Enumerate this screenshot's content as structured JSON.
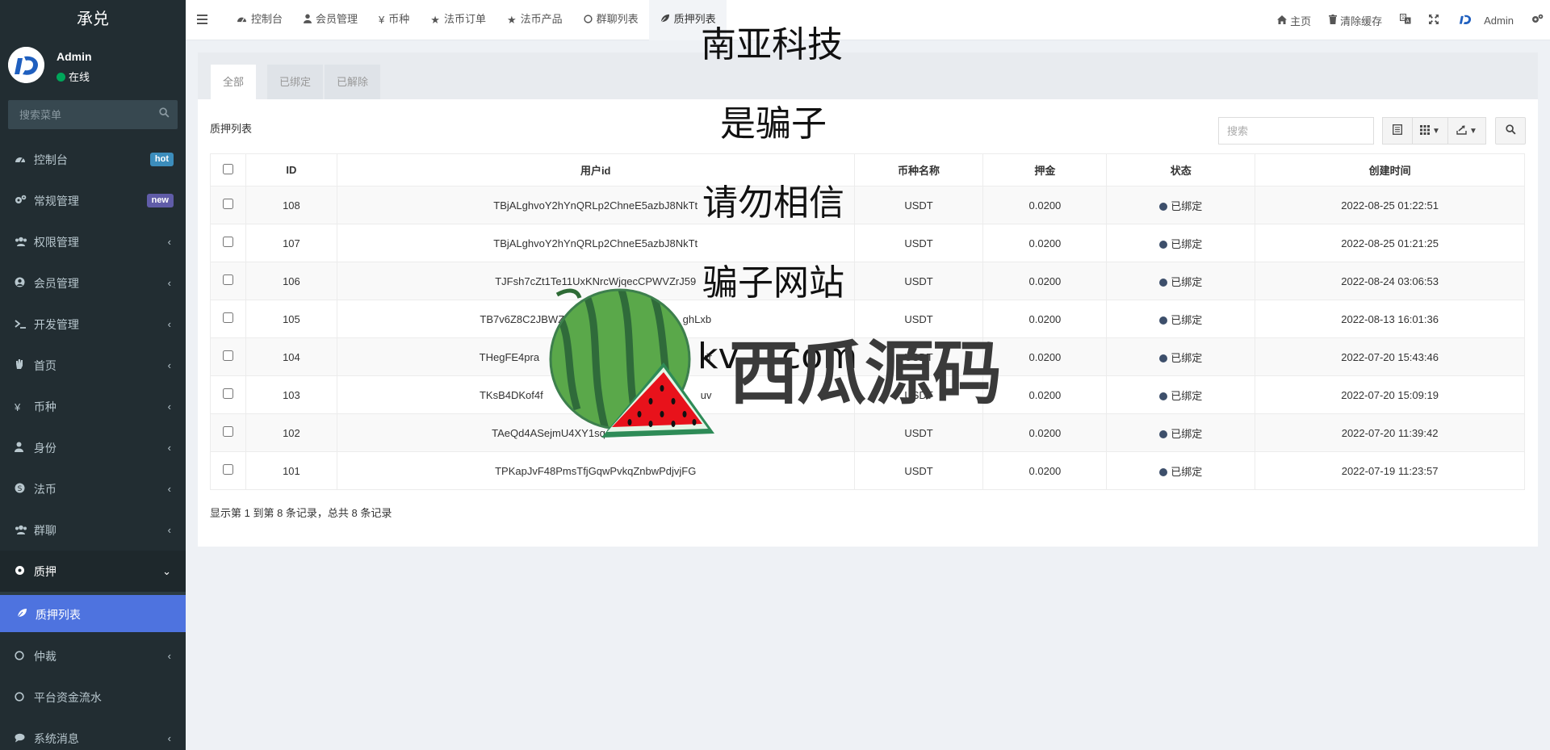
{
  "sidebar": {
    "brand": "承兑",
    "user": {
      "name": "Admin",
      "status": "在线"
    },
    "search_placeholder": "搜索菜单",
    "items": [
      {
        "label": "控制台",
        "icon": "dashboard-icon",
        "badge": "hot"
      },
      {
        "label": "常规管理",
        "icon": "cogs-icon",
        "badge": "new"
      },
      {
        "label": "权限管理",
        "icon": "group-icon"
      },
      {
        "label": "会员管理",
        "icon": "user-circle-icon"
      },
      {
        "label": "开发管理",
        "icon": "terminal-icon"
      },
      {
        "label": "首页",
        "icon": "hand-icon"
      },
      {
        "label": "币种",
        "icon": "yen-icon"
      },
      {
        "label": "身份",
        "icon": "user-icon"
      },
      {
        "label": "法币",
        "icon": "skype-icon"
      },
      {
        "label": "群聊",
        "icon": "users-icon"
      },
      {
        "label": "质押",
        "icon": "gear-icon"
      },
      {
        "label": "质押列表",
        "icon": "leaf-icon"
      },
      {
        "label": "仲裁",
        "icon": "circle-icon"
      },
      {
        "label": "平台资金流水",
        "icon": "circle-icon"
      },
      {
        "label": "系统消息",
        "icon": "comment-icon"
      }
    ]
  },
  "navbar": {
    "tabs": [
      {
        "label": "控制台",
        "icon": "dashboard-icon"
      },
      {
        "label": "会员管理",
        "icon": "user-icon"
      },
      {
        "label": "币种",
        "icon": "yen-icon"
      },
      {
        "label": "法币订单",
        "icon": "star-icon"
      },
      {
        "label": "法币产品",
        "icon": "star-icon"
      },
      {
        "label": "群聊列表",
        "icon": "circle-icon"
      },
      {
        "label": "质押列表",
        "icon": "leaf-icon"
      }
    ],
    "right": {
      "home": "主页",
      "clear_cache": "清除缓存",
      "admin": "Admin"
    }
  },
  "panel": {
    "tabs": [
      "全部",
      "已绑定",
      "已解除"
    ],
    "title": "质押列表",
    "search_placeholder": "搜索"
  },
  "table": {
    "columns": [
      "ID",
      "用户id",
      "币种名称",
      "押金",
      "状态",
      "创建时间"
    ],
    "rows": [
      {
        "id": "108",
        "user": "TBjALghvoY2hYnQRLp2ChneE5azbJ8NkTt",
        "coin": "USDT",
        "deposit": "0.0200",
        "status": "已绑定",
        "created": "2022-08-25 01:22:51"
      },
      {
        "id": "107",
        "user": "TBjALghvoY2hYnQRLp2ChneE5azbJ8NkTt",
        "coin": "USDT",
        "deposit": "0.0200",
        "status": "已绑定",
        "created": "2022-08-25 01:21:25"
      },
      {
        "id": "106",
        "user": "TJFsh7cZt1Te11UxKNrcWjqecCPWVZrJ59",
        "coin": "USDT",
        "deposit": "0.0200",
        "status": "已绑定",
        "created": "2022-08-24 03:06:53"
      },
      {
        "id": "105",
        "user": "TB7v6Z8C2JBWZc",
        "user_tail": "ghLxb",
        "coin": "USDT",
        "deposit": "0.0200",
        "status": "已绑定",
        "created": "2022-08-13 16:01:36"
      },
      {
        "id": "104",
        "user": "THegFE4pra",
        "user_tail": "vir",
        "coin": "USDT",
        "deposit": "0.0200",
        "status": "已绑定",
        "created": "2022-07-20 15:43:46"
      },
      {
        "id": "103",
        "user": "TKsB4DKof4f",
        "user_tail": "uv",
        "coin": "USDT",
        "deposit": "0.0200",
        "status": "已绑定",
        "created": "2022-07-20 15:09:19"
      },
      {
        "id": "102",
        "user": "TAeQd4ASejmU4XY1sqJ",
        "coin": "USDT",
        "deposit": "0.0200",
        "status": "已绑定",
        "created": "2022-07-20 11:39:42"
      },
      {
        "id": "101",
        "user": "TPKapJvF48PmsTfjGqwPvkqZnbwPdjvjFG",
        "coin": "USDT",
        "deposit": "0.0200",
        "status": "已绑定",
        "created": "2022-07-19 11:23:57"
      }
    ]
  },
  "pager": {
    "info": "显示第 1 到第 8 条记录，总共 8 条记录"
  },
  "watermark": {
    "line1": "南亚科技",
    "line2": "是骗子",
    "line3": "请勿相信",
    "line4": "骗子网站",
    "line5": "kv",
    "line5_tail": "com",
    "brand": "西瓜源码"
  },
  "colors": {
    "sidebar_bg": "#222d32",
    "active_menu": "#4e73df",
    "hot_badge": "#3c8dbc",
    "new_badge": "#605ca8",
    "online": "#00a65a"
  }
}
